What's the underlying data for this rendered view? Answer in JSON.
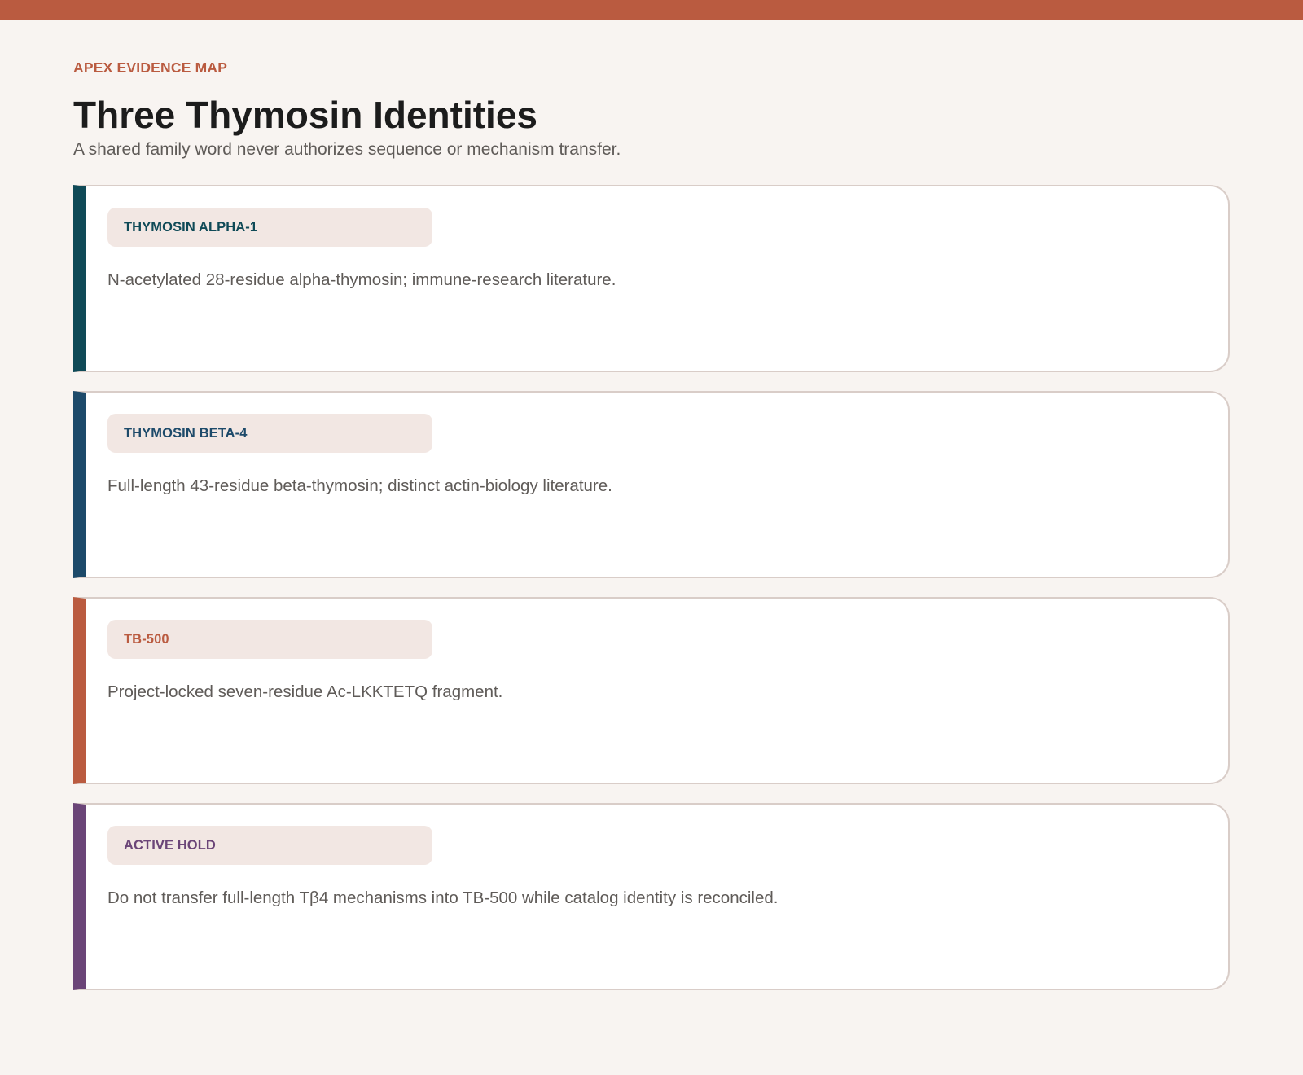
{
  "header": {
    "eyebrow": "APEX EVIDENCE MAP",
    "title": "Three Thymosin Identities",
    "subtitle": "A shared family word never authorizes sequence or mechanism transfer."
  },
  "cards": [
    {
      "tag": "THYMOSIN ALPHA-1",
      "description": "N-acetylated 28-residue alpha-thymosin; immune-research literature.",
      "accent": "#0f4a57"
    },
    {
      "tag": "THYMOSIN BETA-4",
      "description": "Full-length 43-residue beta-thymosin; distinct actin-biology literature.",
      "accent": "#1d4a6a"
    },
    {
      "tag": "TB-500",
      "description": "Project-locked seven-residue Ac-LKKTETQ fragment.",
      "accent": "#ba5b40"
    },
    {
      "tag": "ACTIVE HOLD",
      "description": "Do not transfer full-length Tβ4 mechanisms into TB-500 while catalog identity is reconciled.",
      "accent": "#6b4578"
    }
  ],
  "colors": {
    "top_bar": "#ba5b40",
    "background": "#f8f4f1",
    "card_border": "#d9cdc8",
    "tag_background": "#f2e7e3"
  }
}
